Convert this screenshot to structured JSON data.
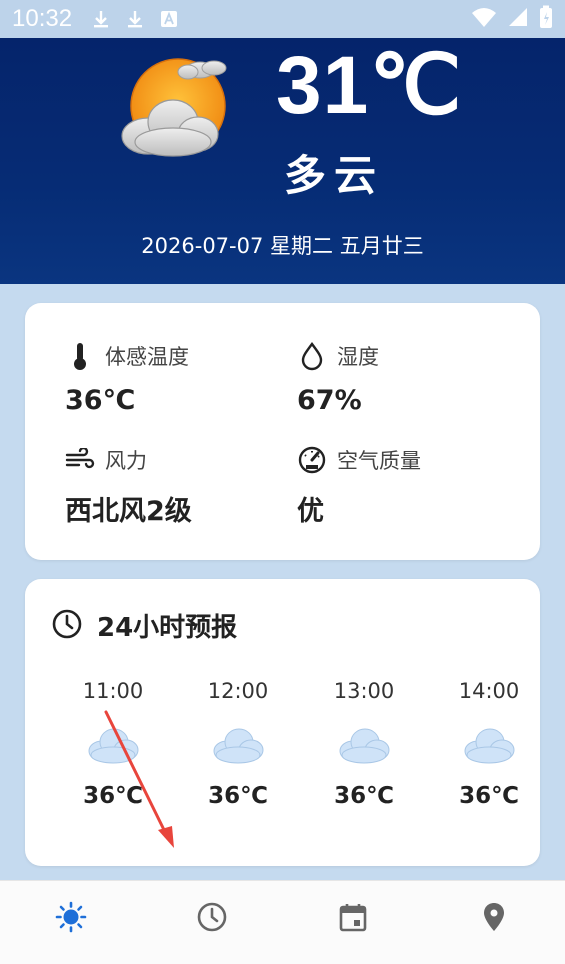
{
  "status_bar": {
    "time": "10:32",
    "icons": [
      "download-icon",
      "download-icon",
      "font-icon",
      "wifi-icon",
      "signal-icon",
      "battery-icon"
    ]
  },
  "current": {
    "temperature": "31℃",
    "condition": "多云",
    "date": "2026-07-07  星期二  五月廿三",
    "icon": "partly-cloudy-icon"
  },
  "details": [
    {
      "icon": "thermometer-icon",
      "label": "体感温度",
      "value": "36℃"
    },
    {
      "icon": "droplet-icon",
      "label": "湿度",
      "value": "67%"
    },
    {
      "icon": "wind-icon",
      "label": "风力",
      "value": "西北风2级"
    },
    {
      "icon": "gauge-icon",
      "label": "空气质量",
      "value": "优"
    }
  ],
  "forecast": {
    "title": "24小时预报",
    "hours": [
      {
        "time": "11:00",
        "icon": "cloud-icon",
        "temp": "36℃"
      },
      {
        "time": "12:00",
        "icon": "cloud-icon",
        "temp": "36℃"
      },
      {
        "time": "13:00",
        "icon": "cloud-icon",
        "temp": "36℃"
      },
      {
        "time": "14:00",
        "icon": "cloud-icon",
        "temp": "36℃"
      }
    ]
  },
  "nav": [
    {
      "icon": "sun-icon",
      "active": true
    },
    {
      "icon": "clock-icon",
      "active": false
    },
    {
      "icon": "calendar-icon",
      "active": false
    },
    {
      "icon": "location-pin-icon",
      "active": false
    }
  ],
  "colors": {
    "header": "#062c75",
    "background": "#c5daef",
    "accent": "#1e6fd8",
    "annotation_arrow": "#e8453c"
  }
}
